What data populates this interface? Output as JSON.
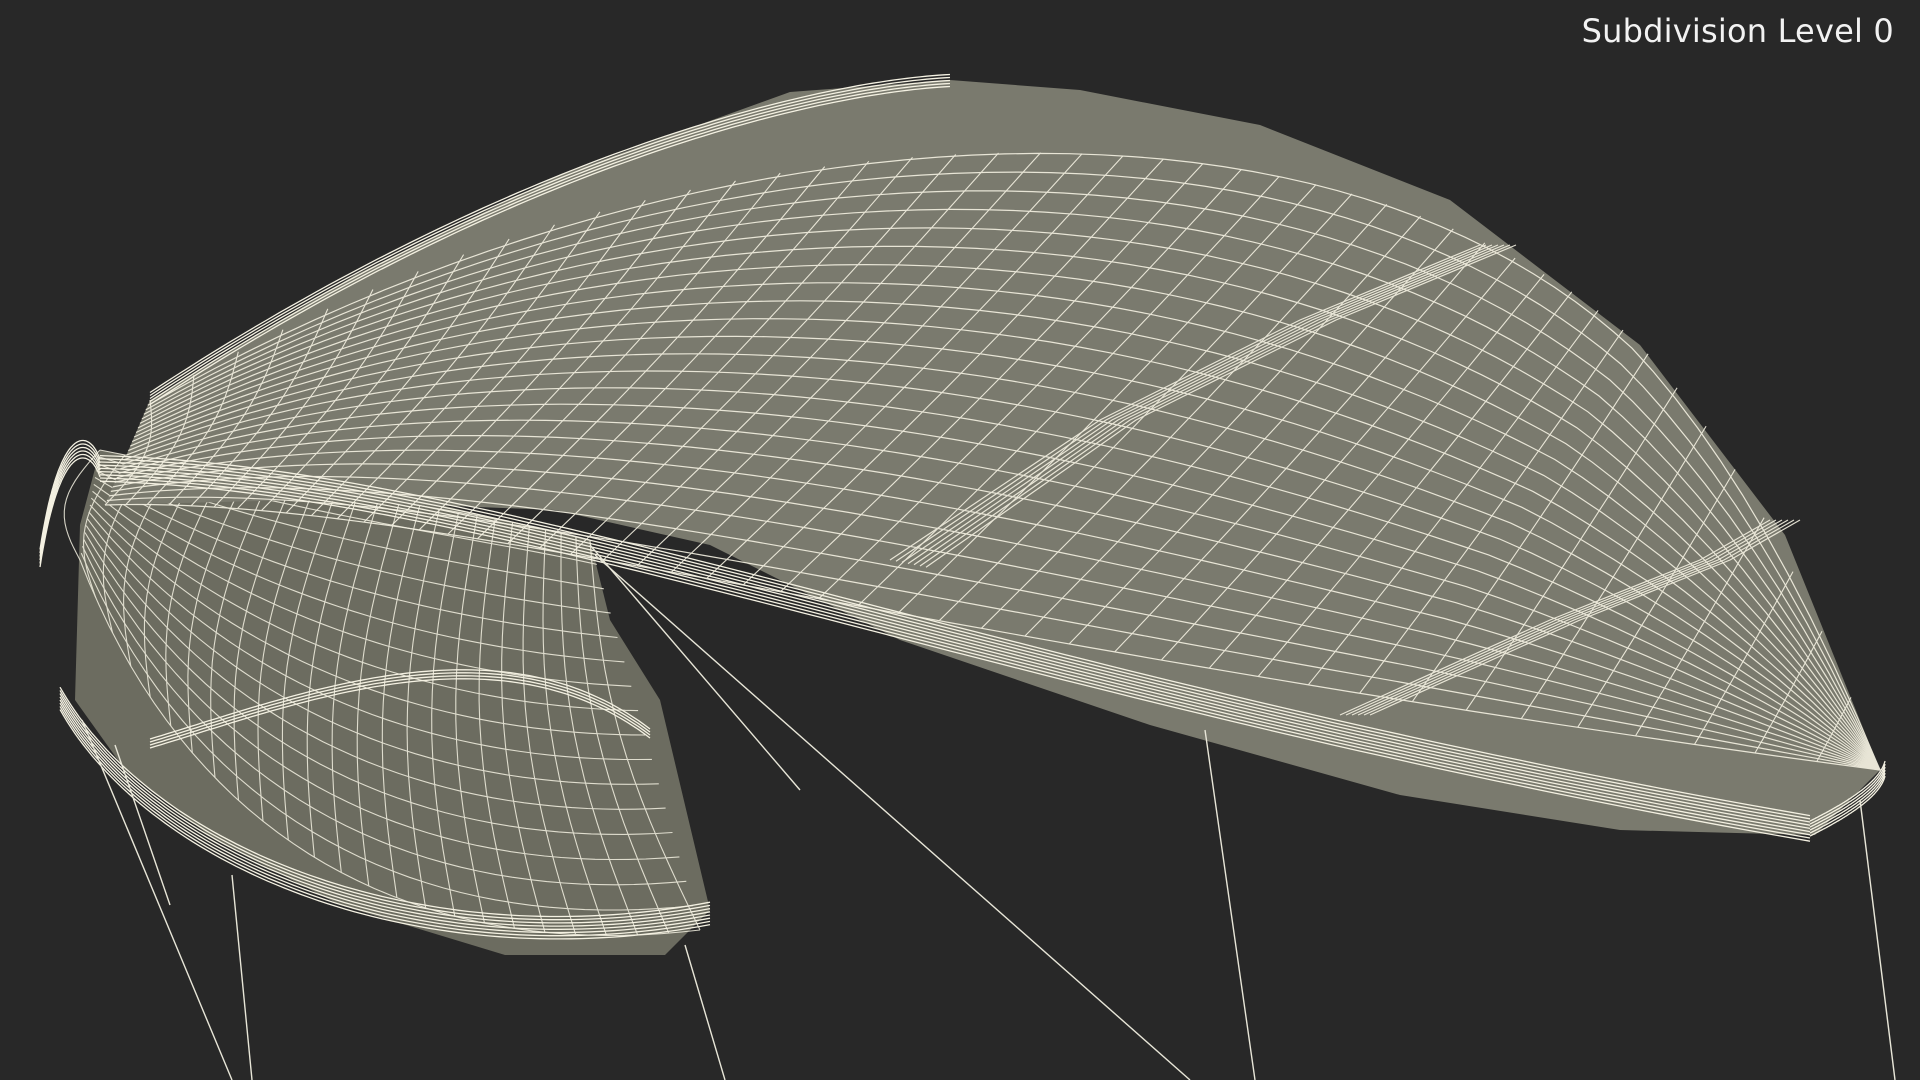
{
  "viewport": {
    "subdivision_label": "Subdivision Level 0",
    "background_color": "#282828",
    "surface_color": "#7a7a6e",
    "inner_surface_color": "#6c6c60",
    "wire_color": "#f4f1e2"
  },
  "model": {
    "icon": "wireframe-mesh"
  }
}
